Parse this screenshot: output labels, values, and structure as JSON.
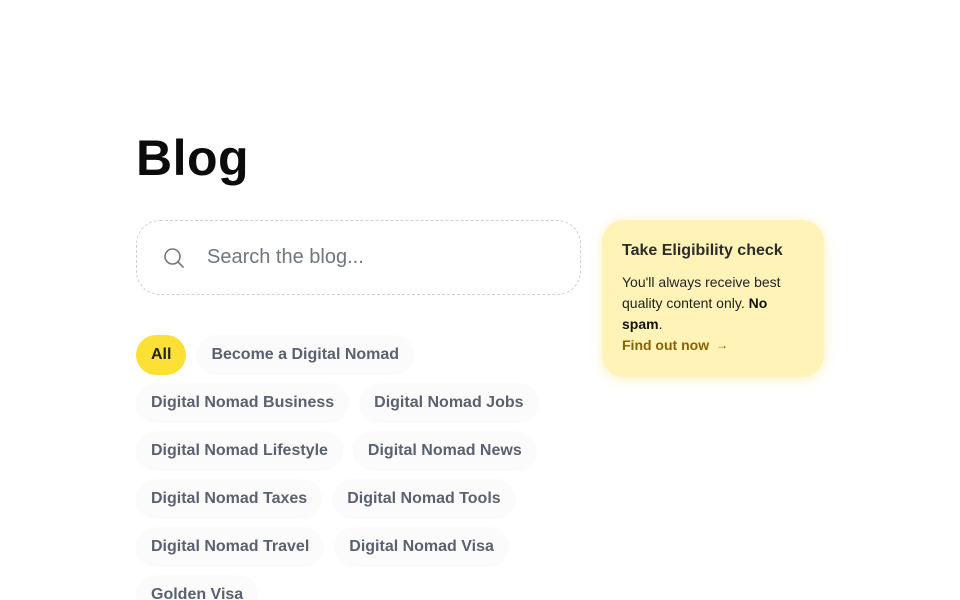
{
  "page": {
    "title": "Blog"
  },
  "search": {
    "placeholder": "Search the blog...",
    "value": "",
    "icon": "search-icon"
  },
  "promo": {
    "title": "Take Eligibility check",
    "text_main": "You'll always receive best quality content only. ",
    "text_bold": "No spam",
    "text_end": ".",
    "link_label": "Find out now",
    "link_icon": "arrow-right-icon",
    "background": "#fff3b8",
    "link_color": "#8a6200"
  },
  "categories": {
    "accent": "#fde036",
    "rows": [
      [
        "All",
        "Become a Digital Nomad"
      ],
      [
        "Digital Nomad Business",
        "Digital Nomad Jobs"
      ],
      [
        "Digital Nomad Lifestyle",
        "Digital Nomad News"
      ],
      [
        "Digital Nomad Taxes",
        "Digital Nomad Tools"
      ],
      [
        "Digital Nomad Travel",
        "Digital Nomad Visa"
      ],
      [
        "Golden Visa"
      ]
    ],
    "active": "All"
  }
}
